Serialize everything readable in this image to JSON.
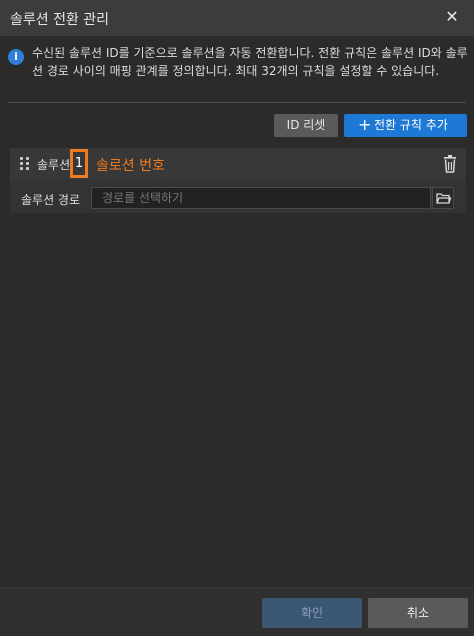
{
  "window": {
    "title": "솔루션 전환 관리",
    "close_icon": "close-icon"
  },
  "info": {
    "icon": "info-icon",
    "text": "수신된 솔루션 ID를 기준으로 솔루션을 자동 전환합니다. 전환 규칙은 솔루션 ID와 솔루션 경로 사이의 매핑 관계를 정의합니다. 최대 32개의 규칙을 설정할 수 있습니다."
  },
  "toolbar": {
    "reset_label": "ID 리셋",
    "add_label": "전환 규칙 추가",
    "add_icon": "plus-icon"
  },
  "rules": [
    {
      "solution_label": "솔루션",
      "solution_id": "1",
      "path_label": "솔루션 경로",
      "path_placeholder": "경로를 선택하기"
    }
  ],
  "annotation": {
    "text": "솔로션 번호",
    "color": "#f07b1e"
  },
  "footer": {
    "ok_label": "확인",
    "cancel_label": "취소"
  },
  "colors": {
    "accent": "#1e78d6",
    "highlight": "#f07b1e"
  }
}
